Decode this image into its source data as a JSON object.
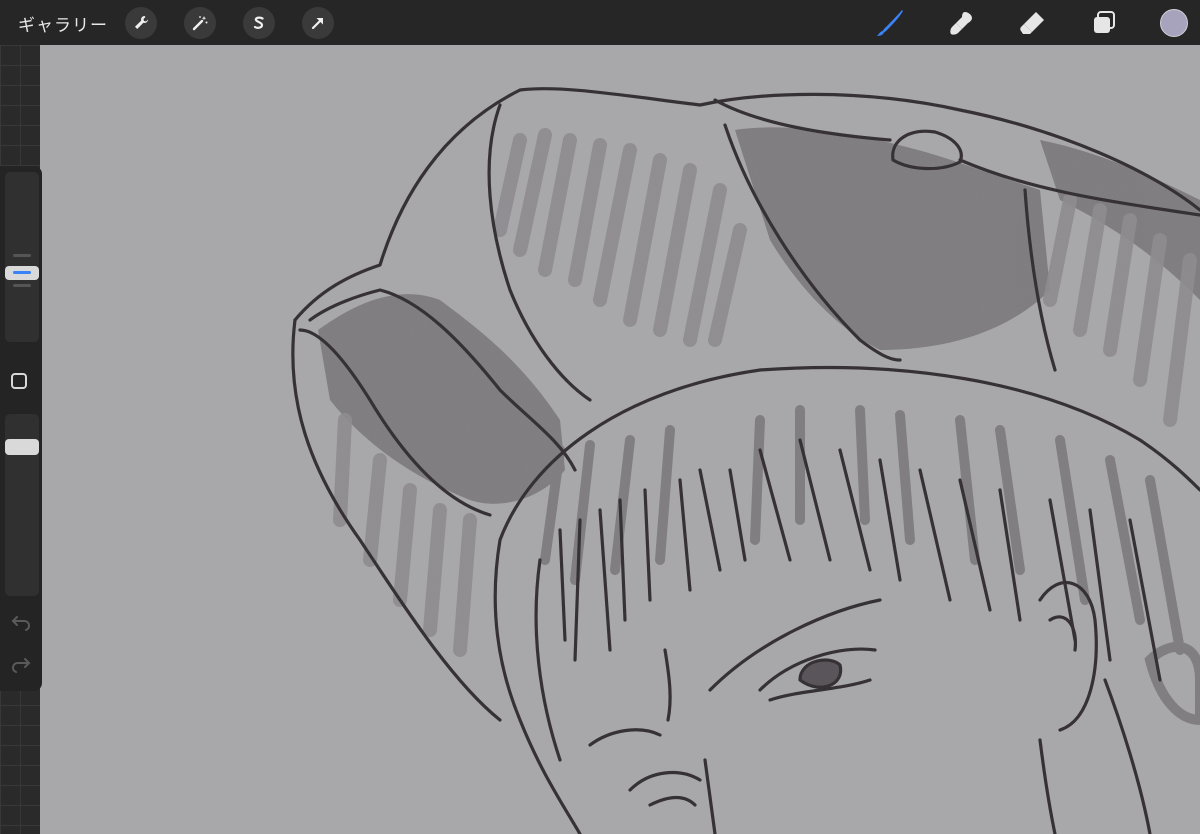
{
  "app": {
    "gallery_label": "ギャラリー"
  },
  "toolbar": {
    "left_tools": [
      {
        "name": "wrench-icon",
        "label": "actions"
      },
      {
        "name": "magic-wand-icon",
        "label": "adjustments"
      },
      {
        "name": "selection-s-icon",
        "label": "selection"
      },
      {
        "name": "arrow-cursor-icon",
        "label": "transform"
      }
    ],
    "right_tools": [
      {
        "name": "brush-icon",
        "active": true
      },
      {
        "name": "smudge-icon",
        "active": false
      },
      {
        "name": "eraser-icon",
        "active": false
      },
      {
        "name": "layers-icon",
        "active": false
      }
    ],
    "current_color": "#a7a3bd"
  },
  "sidebar": {
    "brush_size_level": 0.4,
    "opacity_level": 0.85,
    "icons": [
      "modify-square-icon",
      "undo-icon",
      "redo-icon"
    ]
  },
  "colors": {
    "accent": "#3a82f7",
    "canvas_bg": "#a7a6a9",
    "line": "#2f2a2e",
    "shade_dark": "#7b787c",
    "shade_light": "#928f93"
  }
}
